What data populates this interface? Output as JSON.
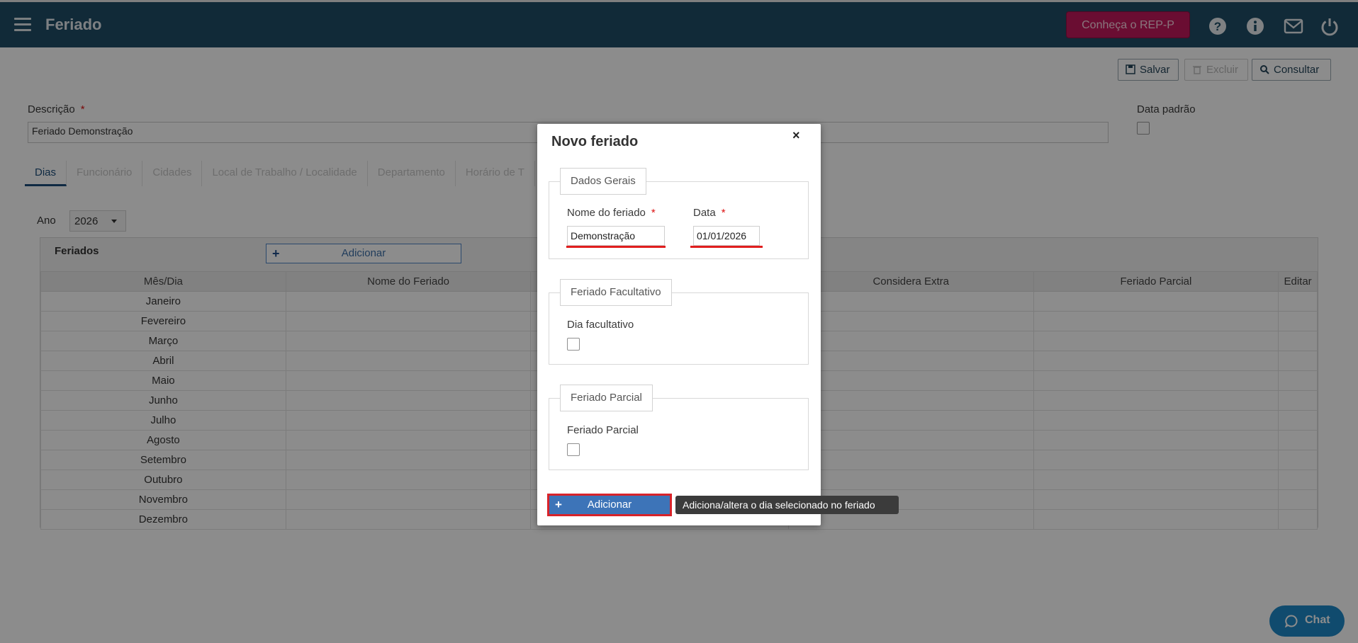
{
  "header": {
    "title": "Feriado",
    "rep_button": "Conheça o REP-P",
    "brand_color": "#1f4e66"
  },
  "toolbar": {
    "save": "Salvar",
    "delete": "Excluir",
    "query": "Consultar"
  },
  "form": {
    "descricao_label": "Descrição",
    "descricao_value": "Feriado Demonstração",
    "data_padrao_label": "Data padrão",
    "required_mark": "*"
  },
  "tabs": [
    "Dias",
    "Funcionário",
    "Cidades",
    "Local de Trabalho / Localidade",
    "Departamento",
    "Horário de T"
  ],
  "year": {
    "label": "Ano",
    "value": "2026"
  },
  "grid": {
    "title": "Feriados",
    "add_button": "Adicionar",
    "columns": [
      "Mês/Dia",
      "Nome do Feriado",
      "",
      "Considera Extra",
      "Feriado Parcial",
      "Editar"
    ],
    "rows": [
      "Janeiro",
      "Fevereiro",
      "Março",
      "Abril",
      "Maio",
      "Junho",
      "Julho",
      "Agosto",
      "Setembro",
      "Outubro",
      "Novembro",
      "Dezembro"
    ]
  },
  "modal": {
    "title": "Novo feriado",
    "close": "×",
    "dados_gerais": {
      "legend": "Dados Gerais",
      "nome_label": "Nome do feriado",
      "nome_value": "Demonstração",
      "data_label": "Data",
      "data_value": "01/01/2026"
    },
    "facultativo": {
      "legend": "Feriado Facultativo",
      "label": "Dia facultativo"
    },
    "parcial": {
      "legend": "Feriado Parcial",
      "label": "Feriado Parcial"
    },
    "add_button": "Adicionar",
    "add_button_highlight": "#d8232a"
  },
  "tooltip": "Adiciona/altera o dia selecionado no feriado",
  "chat": "Chat"
}
